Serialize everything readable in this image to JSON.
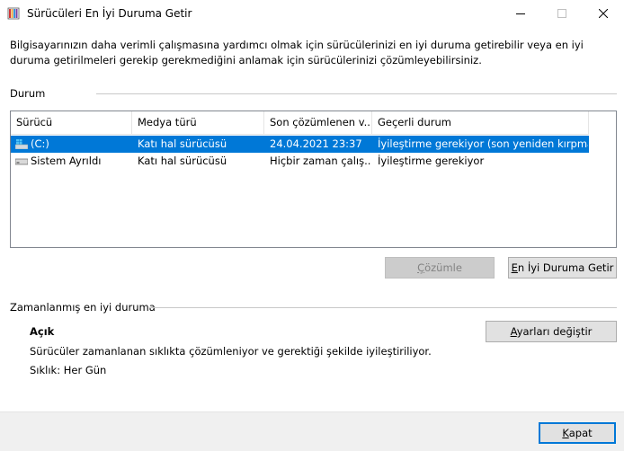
{
  "window": {
    "title": "Sürücüleri En İyi Duruma Getir"
  },
  "intro_text": "Bilgisayarınızın daha verimli çalışmasına yardımcı olmak için sürücülerinizi en iyi duruma getirebilir veya en iyi duruma getirilmeleri gerekip gerekmediğini anlamak için sürücülerinizi çözümleyebilirsiniz.",
  "status_section": {
    "label": "Durum",
    "columns": [
      "Sürücü",
      "Medya türü",
      "Son çözümlenen v...",
      "Geçerli durum"
    ],
    "rows": [
      {
        "drive": "(C:)",
        "media": "Katı hal sürücüsü",
        "last": "24.04.2021 23:37",
        "status": "İyileştirme gerekiyor (son yeniden kırpma...",
        "selected": true,
        "icon": "windows-drive-icon"
      },
      {
        "drive": "Sistem Ayrıldı",
        "media": "Katı hal sürücüsü",
        "last": "Hiçbir zaman çalış...",
        "status": "İyileştirme gerekiyor",
        "selected": false,
        "icon": "drive-icon"
      }
    ],
    "analyze_button": {
      "prefix": "",
      "mnemonic": "Ç",
      "suffix": "özümle"
    },
    "optimize_button": {
      "prefix": "",
      "mnemonic": "E",
      "suffix": "n İyi Duruma Getir"
    }
  },
  "scheduled_section": {
    "label": "Zamanlanmış en iyi duruma",
    "state": "Açık",
    "description": "Sürücüler zamanlanan sıklıkta çözümleniyor ve gerektiği şekilde iyileştiriliyor.",
    "frequency": "Sıklık: Her Gün",
    "change_settings_button": {
      "prefix": "",
      "mnemonic": "A",
      "suffix": "yarları değiştir"
    }
  },
  "close_button": {
    "prefix": "",
    "mnemonic": "K",
    "suffix": "apat"
  },
  "colors": {
    "selection": "#0078d7",
    "button_face": "#e1e1e1",
    "footer_bg": "#f0f0f0"
  }
}
